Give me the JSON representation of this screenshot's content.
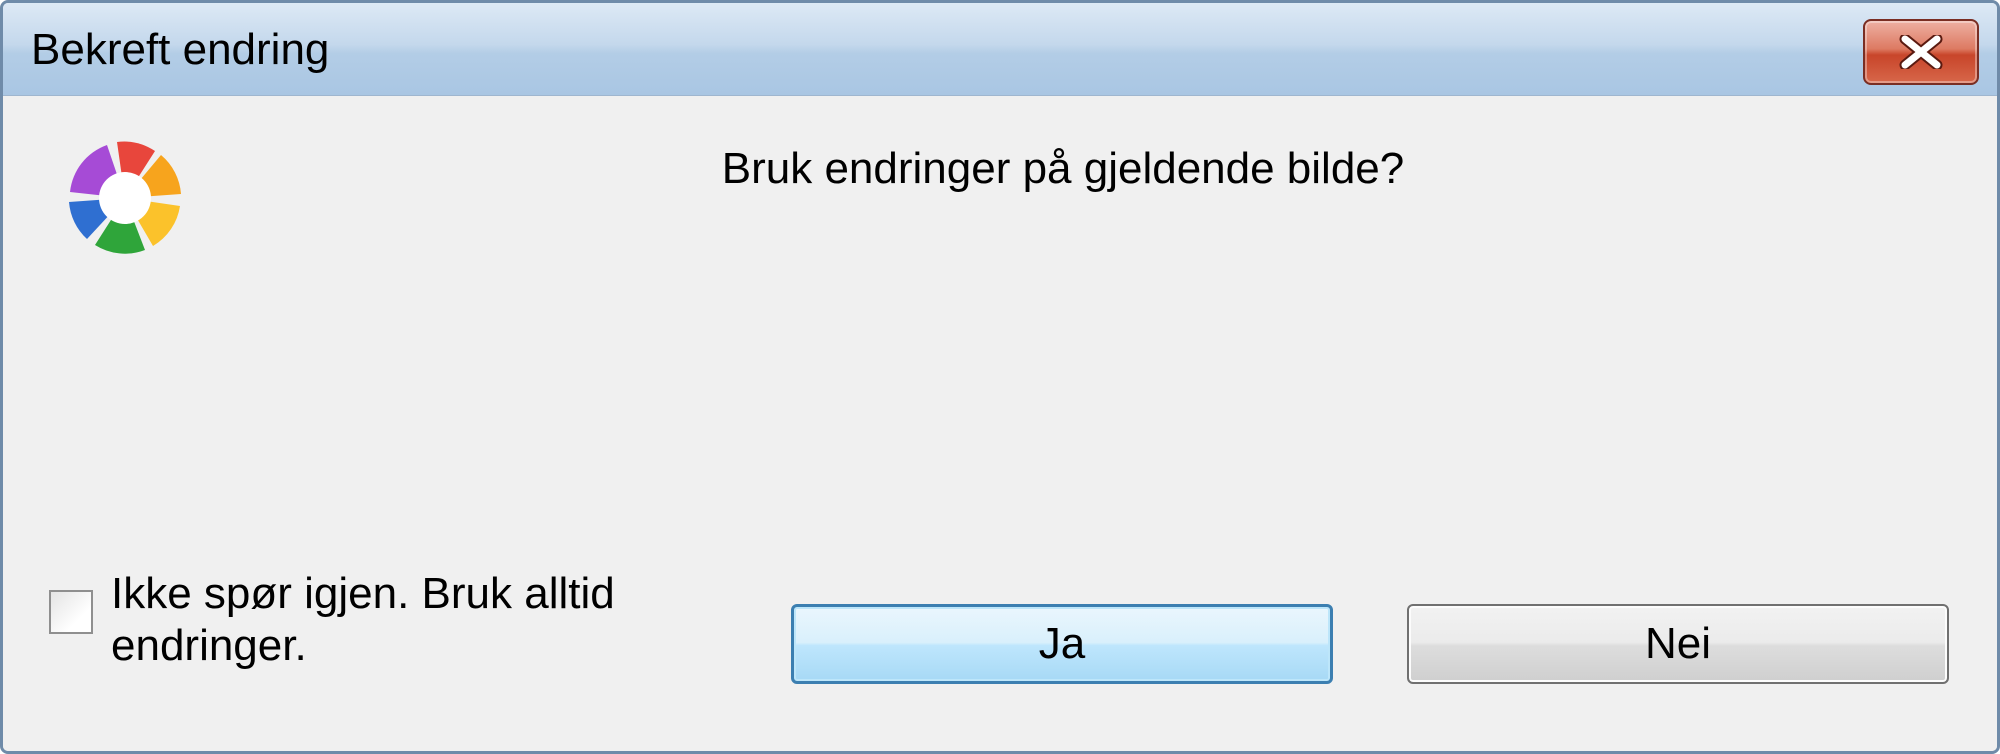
{
  "window": {
    "title": "Bekreft endring",
    "close_icon": "close-icon"
  },
  "dialog": {
    "app_icon": "picasa-logo-icon",
    "message": "Bruk endringer på gjeldende bilde?",
    "checkbox": {
      "label": "Ikke spør igjen. Bruk alltid endringer.",
      "checked": false
    },
    "buttons": {
      "yes_label": "Ja",
      "no_label": "Nei",
      "default": "yes"
    }
  },
  "colors": {
    "titlebar": "#c4d8ec",
    "close_button": "#c8452a",
    "default_button_border": "#3c7fb1",
    "client_background": "#f0f0f0"
  }
}
